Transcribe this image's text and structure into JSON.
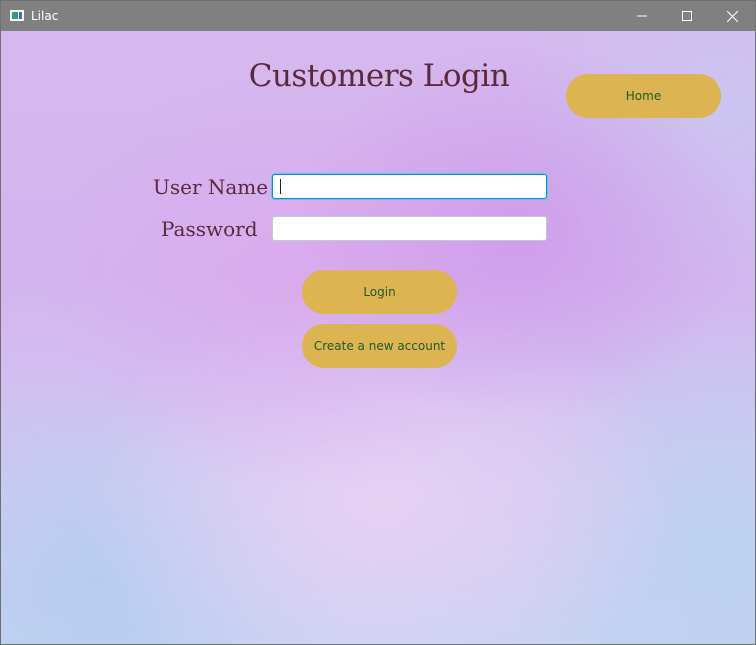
{
  "window": {
    "title": "Lilac",
    "controls": {
      "minimize": "minimize",
      "maximize": "maximize",
      "close": "close"
    }
  },
  "header": {
    "title": "Customers Login",
    "home_label": "Home"
  },
  "form": {
    "username_label": "User Name",
    "username_value": "",
    "password_label": "Password",
    "password_value": ""
  },
  "actions": {
    "login_label": "Login",
    "create_account_label": "Create a new account"
  },
  "colors": {
    "titlebar": "#808080",
    "button_fill": "#dcb451",
    "button_text": "#1e5a2a",
    "heading_text": "#5a2a3c",
    "focus_border": "#0096d6"
  },
  "icons": {
    "app": "app-window-icon",
    "minimize": "minimize-icon",
    "maximize": "maximize-icon",
    "close": "close-icon"
  }
}
